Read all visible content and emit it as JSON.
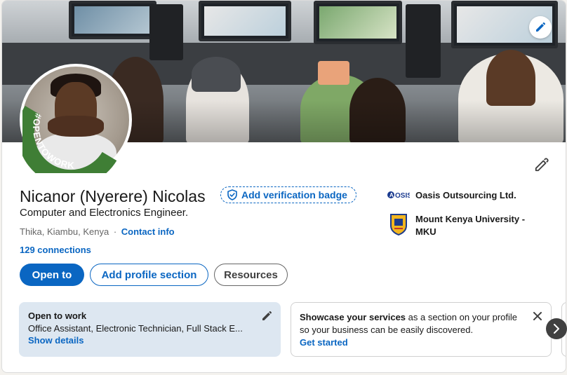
{
  "profile": {
    "name": "Nicanor (Nyerere) Nicolas",
    "verification_badge_label": "Add verification badge",
    "headline": "Computer and Electronics Engineer.",
    "location": "Thika, Kiambu, Kenya",
    "location_separator": "·",
    "contact_info_label": "Contact info",
    "connections_label": "129 connections",
    "open_to_work_frame_text": "#OPENTOWORK",
    "avatar_frame_color": "#3f7e35"
  },
  "experience": [
    {
      "name": "Oasis Outsourcing Ltd.",
      "logo_text": "OSIS",
      "icon": "oasis-logo-icon"
    },
    {
      "name": "Mount Kenya University -",
      "name_line2": "MKU",
      "icon": "mku-crest-icon"
    }
  ],
  "actions": {
    "open_to_label": "Open to",
    "add_section_label": "Add profile section",
    "resources_label": "Resources"
  },
  "open_to_work_card": {
    "title": "Open to work",
    "description": "Office Assistant, Electronic Technician, Full Stack E...",
    "link": "Show details"
  },
  "services_card": {
    "bold_text": "Showcase your services",
    "text": " as a section on your profile",
    "text_line2": "so your business can be easily discovered.",
    "link": "Get started"
  },
  "colors": {
    "accent": "#0a66c2",
    "open_to_work_bg": "#dde7f1"
  }
}
